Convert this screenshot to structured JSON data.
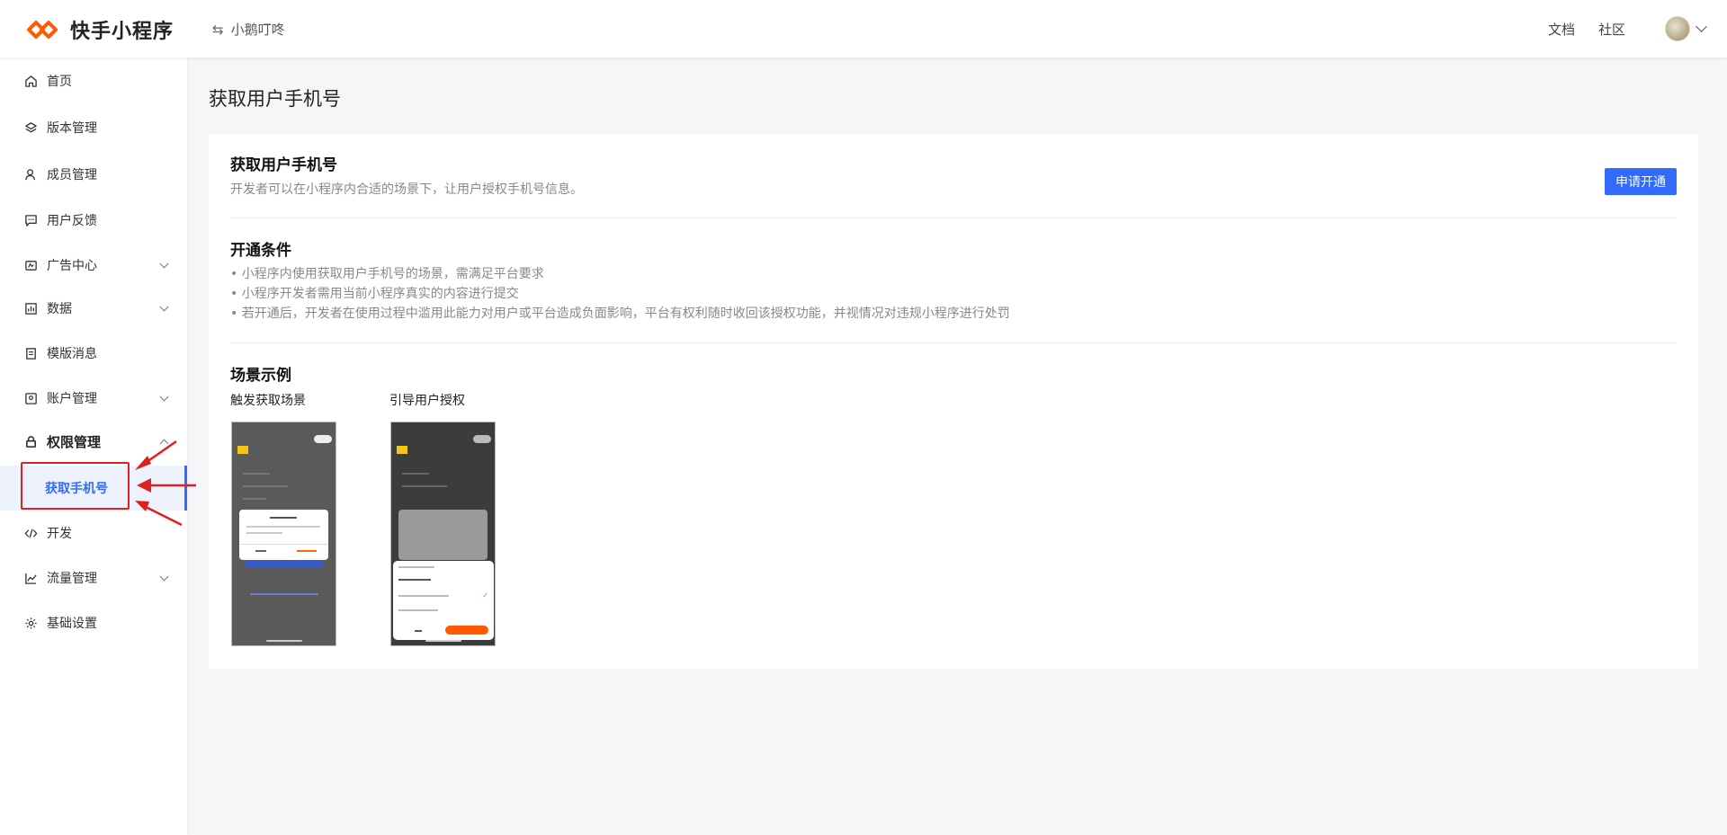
{
  "header": {
    "logo_text": "快手小程序",
    "app_name": "小鹅叮咚",
    "links": [
      "文档",
      "社区"
    ]
  },
  "sidebar": {
    "items": [
      {
        "label": "首页",
        "icon": "home-icon"
      },
      {
        "label": "版本管理",
        "icon": "layers-icon"
      },
      {
        "label": "成员管理",
        "icon": "user-icon"
      },
      {
        "label": "用户反馈",
        "icon": "feedback-icon"
      },
      {
        "label": "广告中心",
        "icon": "ad-icon"
      },
      {
        "label": "数据",
        "icon": "chart-icon"
      },
      {
        "label": "模版消息",
        "icon": "template-icon"
      },
      {
        "label": "账户管理",
        "icon": "account-icon"
      },
      {
        "label": "权限管理",
        "icon": "lock-icon"
      },
      {
        "label": "获取手机号"
      },
      {
        "label": "开发",
        "icon": "code-icon"
      },
      {
        "label": "流量管理",
        "icon": "traffic-icon"
      },
      {
        "label": "基础设置",
        "icon": "gear-icon"
      }
    ]
  },
  "main": {
    "page_title": "获取用户手机号",
    "intro": {
      "title": "获取用户手机号",
      "desc": "开发者可以在小程序内合适的场景下，让用户授权手机号信息。",
      "apply_button": "申请开通"
    },
    "conditions": {
      "title": "开通条件",
      "items": [
        "小程序内使用获取用户手机号的场景，需满足平台要求",
        "小程序开发者需用当前小程序真实的内容进行提交",
        "若开通后，开发者在使用过程中滥用此能力对用户或平台造成负面影响，平台有权利随时收回该授权功能，并视情况对违规小程序进行处罚"
      ]
    },
    "examples": {
      "title": "场景示例",
      "scenes": [
        "触发获取场景",
        "引导用户授权"
      ]
    }
  },
  "colors": {
    "accent": "#326bfb",
    "annotation": "#e02020",
    "logo": "#ff5a00"
  }
}
